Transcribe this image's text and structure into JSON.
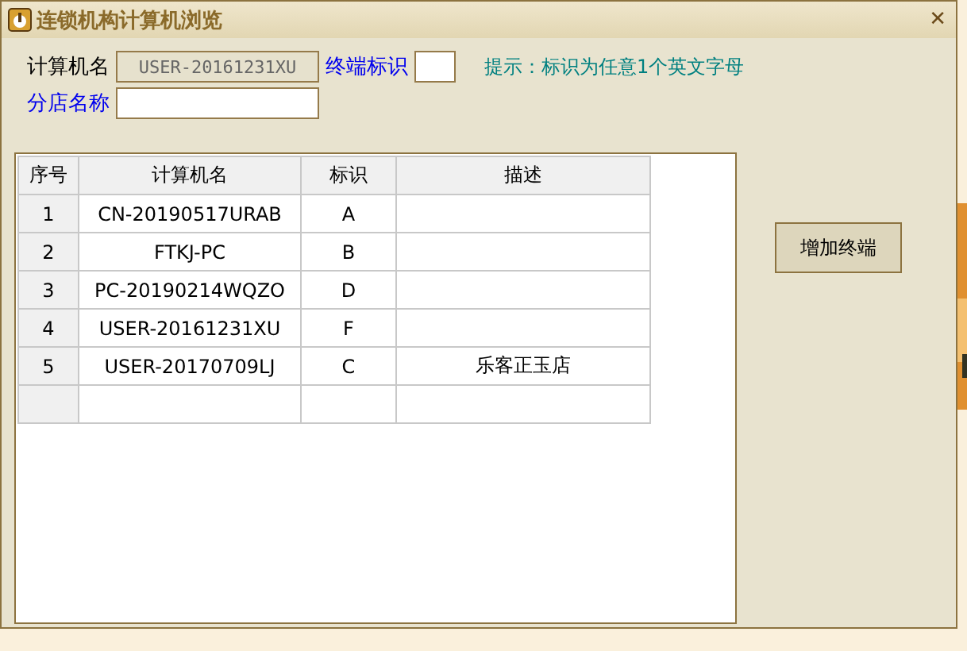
{
  "window": {
    "title": "连锁机构计算机浏览",
    "close": "✕"
  },
  "form": {
    "computer_label": "计算机名",
    "computer_value": "USER-20161231XU",
    "terminal_label": "终端标识",
    "hint": "提示：标识为任意1个英文字母",
    "branch_label": "分店名称"
  },
  "table": {
    "columns": [
      "序号",
      "计算机名",
      "标识",
      "描述"
    ],
    "rows": [
      [
        "1",
        "CN-20190517URAB",
        "A",
        ""
      ],
      [
        "2",
        "FTKJ-PC",
        "B",
        ""
      ],
      [
        "3",
        "PC-20190214WQZO",
        "D",
        ""
      ],
      [
        "4",
        "USER-20161231XU",
        "F",
        ""
      ],
      [
        "5",
        "USER-20170709LJ",
        "C",
        "乐客正玉店"
      ]
    ]
  },
  "buttons": [
    "增加终端"
  ]
}
